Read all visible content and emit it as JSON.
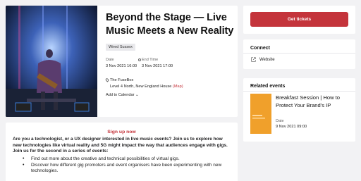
{
  "event": {
    "title": "Beyond the Stage — Live Music Meets a New Reality",
    "tag": "Wired Sussex",
    "start_label": "Date",
    "start_value": "3 Nov 2021 16:00",
    "end_label": "End Time",
    "end_value": "3 Nov 2021 17:00",
    "venue": "The FuseBox",
    "address": "Level 4 North, New England House",
    "map_link": "(Map)",
    "add_to_calendar": "Add to Calendar"
  },
  "tickets": {
    "button_label": "Get tickets"
  },
  "connect": {
    "heading": "Connect",
    "website_label": "Website"
  },
  "related": {
    "heading": "Related events",
    "items": [
      {
        "title": "Breakfast Session | How to Protect Your Brand's IP",
        "date_label": "Date",
        "date_value": "9 Nov 2021 09:00"
      }
    ]
  },
  "description": {
    "signup": "Sign up now",
    "body": "Are you a technologist, or a UX designer interested in live music events? Join us to explore how new technologies like virtual reality and 5G might impact the way that audiences engage with gigs. Join us for the second in a series of events:",
    "bullets": [
      "Find out more about the creative and technical possibilities of virtual gigs.",
      "Discover how different gig promoters and event organisers have been experimenting with new technologies."
    ]
  },
  "colors": {
    "accent": "#c4343b",
    "background": "#f2f2f4",
    "thumb_orange": "#f0a02b"
  },
  "icons": [
    "clock-icon",
    "map-pin-icon",
    "external-link-icon"
  ]
}
